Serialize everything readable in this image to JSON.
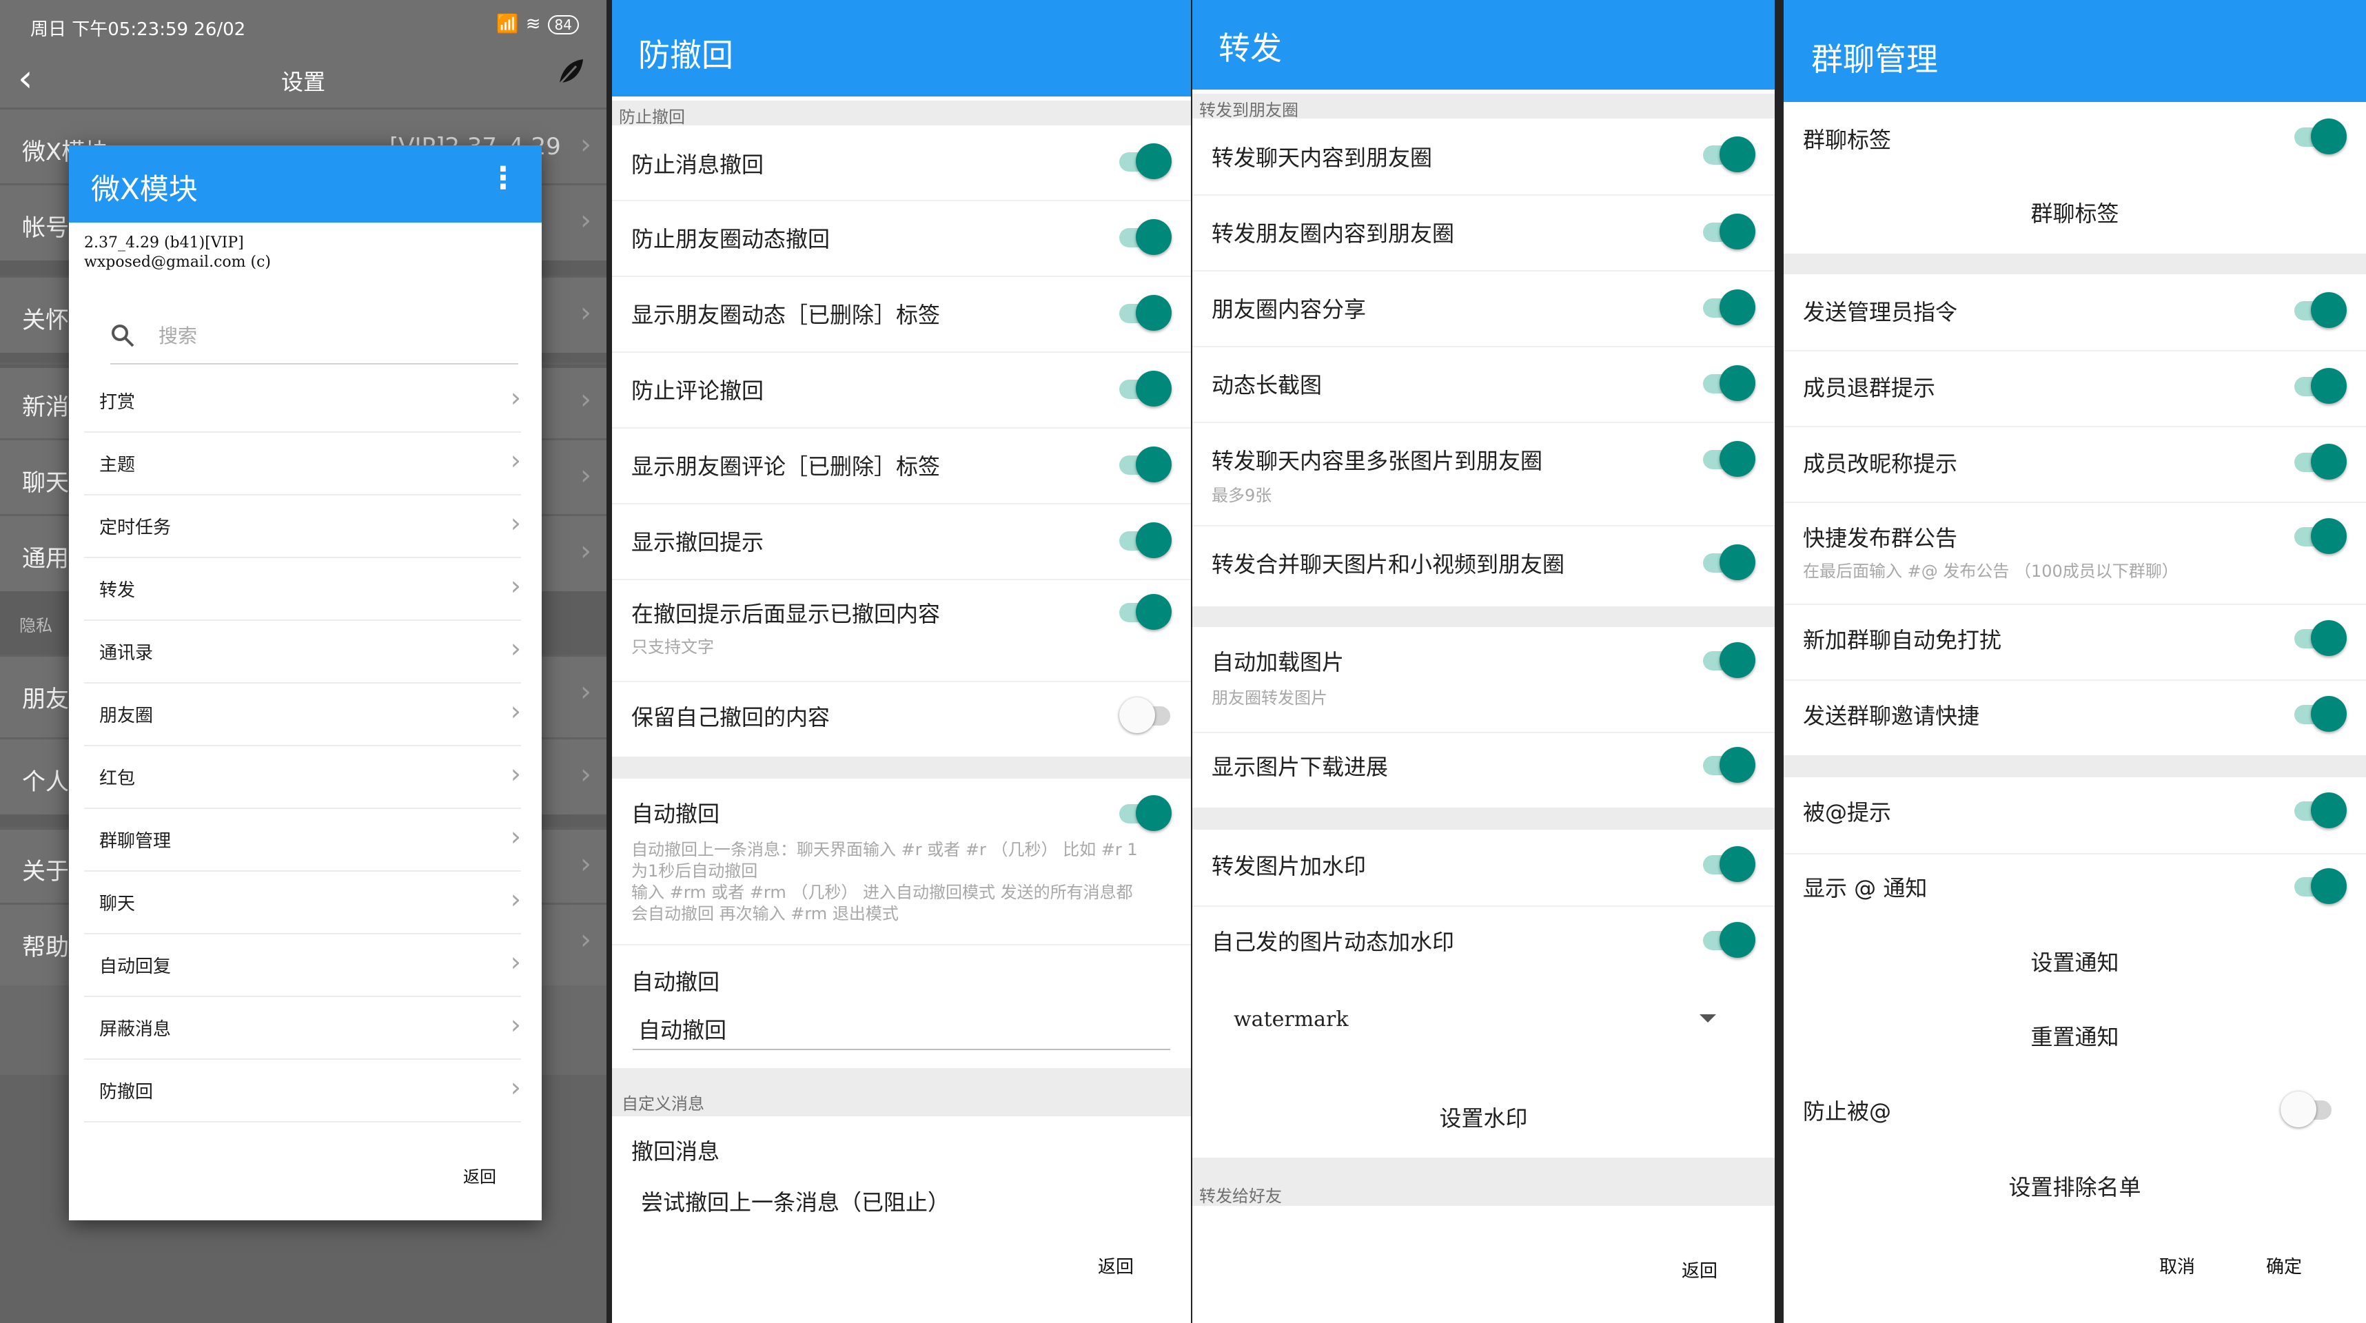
{
  "settings_page": {
    "status": {
      "time": "周日 下午05:23:59 26/02",
      "signal": "📶",
      "wifi": "≋",
      "battery": "84"
    },
    "nav": {
      "back": "‹",
      "title": "设置"
    },
    "rows": [
      {
        "label": "微X模块",
        "value": "[VIP]2.37_4.29"
      },
      {
        "label": "帐号"
      },
      {
        "label": "关怀"
      },
      {
        "label": "新消"
      },
      {
        "label": "聊天"
      },
      {
        "label": "通用"
      },
      {
        "label": "朋友"
      },
      {
        "label": "个人"
      },
      {
        "label": "关于"
      },
      {
        "label": "帮助"
      }
    ],
    "section_privacy": "隐私"
  },
  "module_dialog": {
    "title": "微X模块",
    "info_line1": "2.37_4.29 (b41)[VIP]",
    "info_line2": "wxposed@gmail.com (c)",
    "search_placeholder": "搜索",
    "items": [
      "打赏",
      "主题",
      "定时任务",
      "转发",
      "通讯录",
      "朋友圈",
      "红包",
      "群聊管理",
      "聊天",
      "自动回复",
      "屏蔽消息",
      "防撤回"
    ],
    "back": "返回"
  },
  "anti_recall": {
    "title": "防撤回",
    "section1": "防止撤回",
    "toggles": [
      {
        "label": "防止消息撤回",
        "on": true
      },
      {
        "label": "防止朋友圈动态撤回",
        "on": true
      },
      {
        "label": "显示朋友圈动态［已删除］标签",
        "on": true
      },
      {
        "label": "防止评论撤回",
        "on": true
      },
      {
        "label": "显示朋友圈评论［已删除］标签",
        "on": true
      },
      {
        "label": "显示撤回提示",
        "on": true
      },
      {
        "label": "在撤回提示后面显示已撤回内容",
        "sub": "只支持文字",
        "on": true
      },
      {
        "label": "保留自己撤回的内容",
        "on": false
      }
    ],
    "auto_recall": {
      "label": "自动撤回",
      "on": true,
      "desc_line1": "自动撤回上一条消息：聊天界面输入 #r 或者 #r （几秒） 比如 #r 1",
      "desc_line2": "为1秒后自动撤回",
      "desc_line3": "输入 #rm 或者 #rm （几秒） 进入自动撤回模式 发送的所有消息都",
      "desc_line4": "会自动撤回 再次输入 #rm 退出模式"
    },
    "auto_recall_field": {
      "label": "自动撤回",
      "value": "自动撤回"
    },
    "section2": "自定义消息",
    "recall_message": {
      "label": "撤回消息",
      "value": "尝试撤回上一条消息（已阻止）"
    },
    "back": "返回"
  },
  "forward": {
    "title": "转发",
    "section1": "转发到朋友圈",
    "group1": [
      {
        "label": "转发聊天内容到朋友圈",
        "on": true
      },
      {
        "label": "转发朋友圈内容到朋友圈",
        "on": true
      },
      {
        "label": "朋友圈内容分享",
        "on": true
      },
      {
        "label": "动态长截图",
        "on": true
      },
      {
        "label": "转发聊天内容里多张图片到朋友圈",
        "sub": "最多9张",
        "on": true
      },
      {
        "label": "转发合并聊天图片和小视频到朋友圈",
        "on": true
      }
    ],
    "group2": [
      {
        "label": "自动加载图片",
        "sub": "朋友圈转发图片",
        "on": true
      },
      {
        "label": "显示图片下载进展",
        "on": true
      }
    ],
    "group3": [
      {
        "label": "转发图片加水印",
        "on": true
      },
      {
        "label": "自己发的图片动态加水印",
        "on": true
      }
    ],
    "watermark_select": "watermark",
    "set_watermark": "设置水印",
    "section2": "转发给好友",
    "back": "返回"
  },
  "group_manage": {
    "title": "群聊管理",
    "tag_toggle": {
      "label": "群聊标签",
      "on": true
    },
    "tag_button": "群聊标签",
    "group2": [
      {
        "label": "发送管理员指令",
        "on": true
      },
      {
        "label": "成员退群提示",
        "on": true
      },
      {
        "label": "成员改昵称提示",
        "on": true
      },
      {
        "label": "快捷发布群公告",
        "sub": "在最后面输入 #@ 发布公告 （100成员以下群聊）",
        "on": true
      },
      {
        "label": "新加群聊自动免打扰",
        "on": true
      },
      {
        "label": "发送群聊邀请快捷",
        "on": true
      }
    ],
    "group3": [
      {
        "label": "被@提示",
        "on": true
      },
      {
        "label": "显示 @ 通知",
        "on": true
      }
    ],
    "set_notify": "设置通知",
    "reset_notify": "重置通知",
    "prevent_at": {
      "label": "防止被@",
      "on": false
    },
    "exclude_list": "设置排除名单",
    "cancel": "取消",
    "confirm": "确定"
  },
  "colors": {
    "primary": "#2196f3",
    "switch_on": "#00897b",
    "switch_track": "#a6dcd2"
  }
}
